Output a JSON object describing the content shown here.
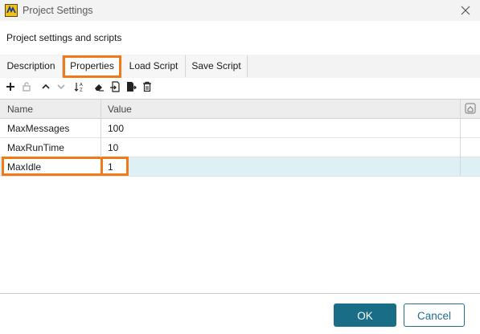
{
  "window": {
    "title": "Project Settings",
    "subtitle": "Project settings and scripts"
  },
  "tabs": [
    {
      "label": "Description"
    },
    {
      "label": "Properties",
      "active": true
    },
    {
      "label": "Load Script"
    },
    {
      "label": "Save Script"
    }
  ],
  "toolbar": {
    "icons": [
      "add-icon",
      "lock-icon",
      "move-up-icon",
      "move-down-icon",
      "sort-icon",
      "eraser-icon",
      "import-icon",
      "export-icon",
      "delete-icon"
    ]
  },
  "grid": {
    "headers": {
      "name": "Name",
      "value": "Value"
    },
    "rows": [
      {
        "name": "MaxMessages",
        "value": "100"
      },
      {
        "name": "MaxRunTime",
        "value": "10"
      },
      {
        "name": "MaxIdle",
        "value": "1",
        "selected": true
      }
    ]
  },
  "buttons": {
    "ok": "OK",
    "cancel": "Cancel"
  },
  "colors": {
    "accent": "#1a6d87",
    "highlight": "#f07a1a",
    "selected_row": "#dff0f4"
  }
}
